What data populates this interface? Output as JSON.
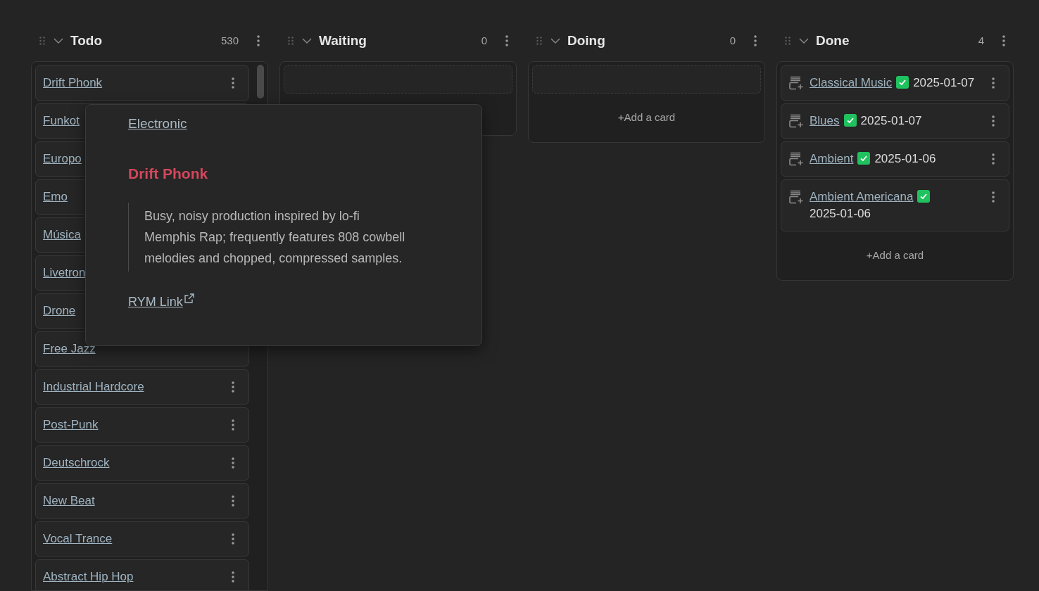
{
  "lanes": [
    {
      "title": "Todo",
      "count": "530",
      "expanded": true,
      "cards": [
        {
          "title": "Drift Phonk",
          "covered": false
        },
        {
          "title": "Funkot",
          "covered": true
        },
        {
          "title": "Europo",
          "covered": true
        },
        {
          "title": "Emo",
          "covered": true
        },
        {
          "title": "Música",
          "covered": true
        },
        {
          "title": "Livetron",
          "covered": true
        },
        {
          "title": "Drone",
          "covered": true
        },
        {
          "title": "Free Jazz",
          "covered": true
        },
        {
          "title": "Industrial Hardcore",
          "covered": false
        },
        {
          "title": "Post-Punk",
          "covered": false
        },
        {
          "title": "Deutschrock",
          "covered": false
        },
        {
          "title": "New Beat",
          "covered": false
        },
        {
          "title": "Vocal Trance",
          "covered": false
        },
        {
          "title": "Abstract Hip Hop",
          "covered": false
        }
      ]
    },
    {
      "title": "Waiting",
      "count": "0",
      "expanded": true,
      "placeholder": true
    },
    {
      "title": "Doing",
      "count": "0",
      "expanded": true,
      "placeholder": true,
      "add_card": "+Add a card"
    },
    {
      "title": "Done",
      "count": "4",
      "expanded": true,
      "add_card": "+Add a card",
      "cards": [
        {
          "title": "Classical Music",
          "checked": true,
          "date": "2025-01-07",
          "covered": false
        },
        {
          "title": "Blues",
          "checked": true,
          "date": "2025-01-07",
          "covered": false
        },
        {
          "title": "Ambient",
          "checked": true,
          "date": "2025-01-06",
          "covered": false
        },
        {
          "title": "Ambient Americana",
          "checked": true,
          "date": "2025-01-06",
          "covered": false
        }
      ]
    }
  ],
  "popover": {
    "tag": "Electronic",
    "heading": "Drift Phonk",
    "description": "Busy, noisy production inspired by lo-fi Memphis Rap; frequently features 808 cowbell melodies and chopped, compressed samples.",
    "link": "RYM Link"
  }
}
